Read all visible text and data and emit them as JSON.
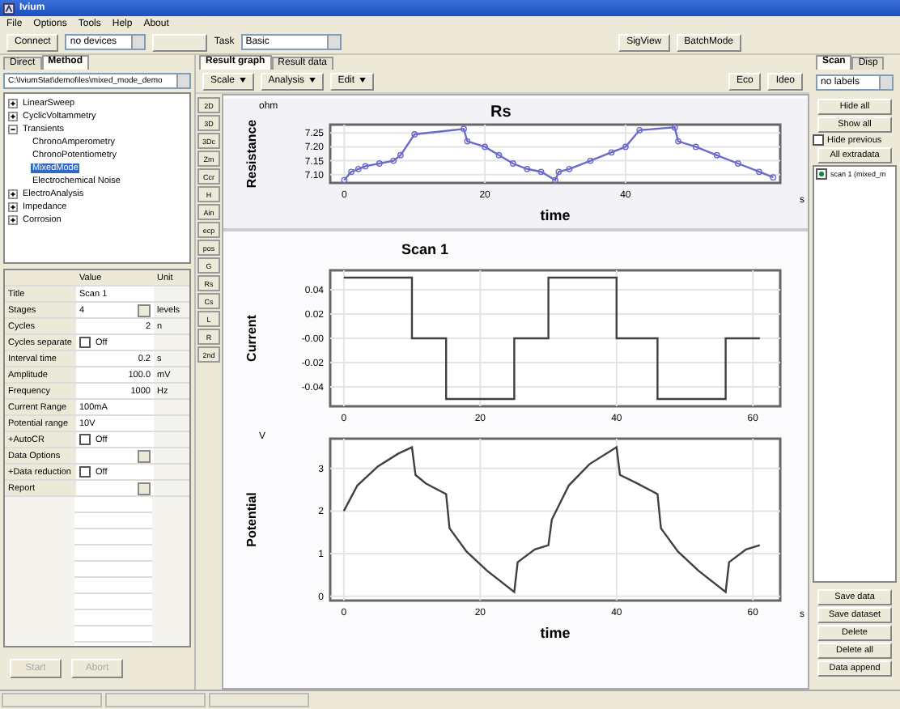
{
  "window": {
    "title": "Ivium"
  },
  "menu": [
    "File",
    "Options",
    "Tools",
    "Help",
    "About"
  ],
  "toolbar": {
    "connect": "Connect",
    "device": "no devices",
    "task": "Task",
    "mode": "Basic",
    "buttons": [
      "SigView",
      "BatchMode"
    ]
  },
  "left": {
    "tabs": [
      {
        "label": "Direct",
        "selected": false
      },
      {
        "label": "Method",
        "selected": true
      }
    ],
    "path": "C:\\IviumStat\\demofiles\\mixed_mode_demo",
    "tree": [
      {
        "label": "LinearSweep",
        "expanded": false,
        "selected": false
      },
      {
        "label": "CyclicVoltammetry",
        "expanded": false,
        "selected": false
      },
      {
        "label": "Transients",
        "expanded": true,
        "selected": false,
        "children": [
          {
            "label": "ChronoAmperometry",
            "selected": false
          },
          {
            "label": "ChronoPotentiometry",
            "selected": false
          },
          {
            "label": "MixedMode",
            "selected": true
          },
          {
            "label": "Electrochemical Noise",
            "selected": false
          }
        ]
      },
      {
        "label": "ElectroAnalysis",
        "expanded": false,
        "selected": false
      },
      {
        "label": "Impedance",
        "expanded": false,
        "selected": false
      },
      {
        "label": "Corrosion",
        "expanded": false,
        "selected": false
      }
    ],
    "grid_header": {
      "value": "Value",
      "unit": "Unit"
    },
    "params": [
      {
        "kind": "text",
        "name": "Title",
        "value": "Scan 1"
      },
      {
        "kind": "ellipsis",
        "name": "Stages",
        "value": "4",
        "unit": "levels"
      },
      {
        "kind": "number",
        "name": "Cycles",
        "value": "2",
        "unit": "n"
      },
      {
        "kind": "check",
        "name": "Cycles separate",
        "checked": false,
        "value": "Off"
      },
      {
        "kind": "number",
        "name": "Interval time",
        "value": "0.2",
        "unit": "s"
      },
      {
        "kind": "number",
        "name": "Amplitude",
        "value": "100.0",
        "unit": "mV"
      },
      {
        "kind": "number",
        "name": "Frequency",
        "value": "1000",
        "unit": "Hz"
      },
      {
        "kind": "text",
        "name": "Current Range",
        "value": "100mA"
      },
      {
        "kind": "text",
        "name": "Potential range",
        "value": "10V"
      },
      {
        "kind": "check",
        "name": "+AutoCR",
        "checked": false,
        "value": "Off"
      },
      {
        "kind": "ellipsis",
        "name": "Data Options"
      },
      {
        "kind": "check",
        "name": "+Data reduction",
        "checked": false,
        "value": "Off"
      },
      {
        "kind": "ellipsis",
        "name": "Report"
      }
    ],
    "buttons": [
      {
        "label": "Start",
        "disabled": true
      },
      {
        "label": "Abort",
        "disabled": true
      }
    ]
  },
  "center": {
    "tabs": [
      {
        "label": "Result graph",
        "selected": true
      },
      {
        "label": "Result data",
        "selected": false
      }
    ],
    "menus": [
      "Scale",
      "Analysis",
      "Edit"
    ],
    "right_buttons": [
      "Eco",
      "Ideo"
    ],
    "side_buttons": [
      "2D",
      "3D",
      "3Dc",
      "Zm",
      "Ccr",
      "H",
      "Ain",
      "ecp",
      "pos",
      "G",
      "Rs",
      "Cs",
      "L",
      "R",
      "2nd"
    ]
  },
  "graph": {
    "scan_title": "Scan 1",
    "charts": [
      {
        "y_unit": "ohm",
        "x_unit": "s",
        "chart_data": {
          "type": "line",
          "title": "Rs",
          "xlabel": "time",
          "ylabel": "Resistance",
          "x": [
            0,
            1,
            2,
            3,
            5,
            7,
            8,
            10,
            17,
            17.5,
            20,
            22,
            24,
            26,
            28,
            30,
            30.5,
            32,
            35,
            38,
            40,
            42,
            47,
            47.5,
            50,
            53,
            56,
            59,
            61
          ],
          "grid": true,
          "series": [
            {
              "color": "#6a6ac8",
              "marker": "circle",
              "values": [
                7.08,
                7.11,
                7.12,
                7.13,
                7.14,
                7.15,
                7.17,
                7.245,
                7.265,
                7.22,
                7.2,
                7.17,
                7.14,
                7.12,
                7.11,
                7.08,
                7.11,
                7.12,
                7.15,
                7.18,
                7.2,
                7.26,
                7.27,
                7.22,
                7.2,
                7.17,
                7.14,
                7.11,
                7.09
              ]
            }
          ],
          "xlim": [
            -2,
            62
          ],
          "ylim": [
            7.07,
            7.28
          ],
          "xticks": [
            0,
            20,
            40
          ],
          "yticks": [
            {
              "value": 7.1,
              "label": "7.10"
            },
            {
              "value": 7.15,
              "label": "7.15"
            },
            {
              "value": 7.2,
              "label": "7.20"
            },
            {
              "value": 7.25,
              "label": "7.25"
            }
          ]
        }
      },
      {
        "chart_data": {
          "type": "line",
          "ylabel": "Current",
          "x": [
            0,
            10,
            10,
            15,
            15,
            25,
            25,
            30,
            30,
            40,
            40,
            46,
            46,
            56,
            56,
            61
          ],
          "grid": true,
          "series": [
            {
              "color": "#404040",
              "values": [
                0.05,
                0.05,
                0,
                0,
                -0.05,
                -0.05,
                0,
                0,
                0.05,
                0.05,
                0,
                0,
                -0.05,
                -0.05,
                0,
                0
              ]
            }
          ],
          "xlim": [
            -2,
            64
          ],
          "ylim": [
            -0.056,
            0.056
          ],
          "xticks": [
            0,
            20,
            40,
            60
          ],
          "yticks": [
            {
              "value": 0.04,
              "label": "0.04"
            },
            {
              "value": 0.02,
              "label": "0.02"
            },
            {
              "value": 0,
              "label": "-0.00"
            },
            {
              "value": -0.02,
              "label": "-0.02"
            },
            {
              "value": -0.04,
              "label": "-0.04"
            }
          ]
        }
      },
      {
        "y_unit": "V",
        "x_unit": "s",
        "chart_data": {
          "type": "line",
          "xlabel": "time",
          "ylabel": "Potential",
          "x": [
            0,
            2,
            5,
            8,
            10,
            10.5,
            12,
            15,
            15.5,
            18,
            21,
            25,
            25.5,
            28,
            30,
            30.5,
            33,
            36,
            40,
            40.5,
            43,
            46,
            46.5,
            49,
            52,
            56,
            56.5,
            59,
            61
          ],
          "grid": true,
          "series": [
            {
              "color": "#404040",
              "values": [
                2,
                2.6,
                3.05,
                3.35,
                3.5,
                2.85,
                2.65,
                2.4,
                1.6,
                1.05,
                0.6,
                0.1,
                0.8,
                1.1,
                1.2,
                1.8,
                2.6,
                3.1,
                3.5,
                2.85,
                2.65,
                2.4,
                1.6,
                1.05,
                0.6,
                0.1,
                0.8,
                1.1,
                1.2
              ]
            }
          ],
          "xlim": [
            -2,
            64
          ],
          "ylim": [
            -0.1,
            3.7
          ],
          "xticks": [
            0,
            20,
            40,
            60
          ],
          "yticks": [
            0,
            1,
            2,
            3
          ]
        }
      }
    ]
  },
  "right": {
    "tabs": [
      {
        "label": "Scan",
        "selected": true
      },
      {
        "label": "Disp",
        "selected": false
      }
    ],
    "labels": "no labels",
    "hide_all": "Hide all",
    "show_all": "Show all",
    "hide_previous": {
      "label": "Hide previous",
      "checked": false
    },
    "extradata": "All extradata",
    "list": [
      {
        "label": "scan 1 (mixed_m",
        "checked": true
      }
    ],
    "buttons": [
      "Save data",
      "Save dataset",
      "Delete",
      "Delete all",
      "Data append"
    ]
  }
}
